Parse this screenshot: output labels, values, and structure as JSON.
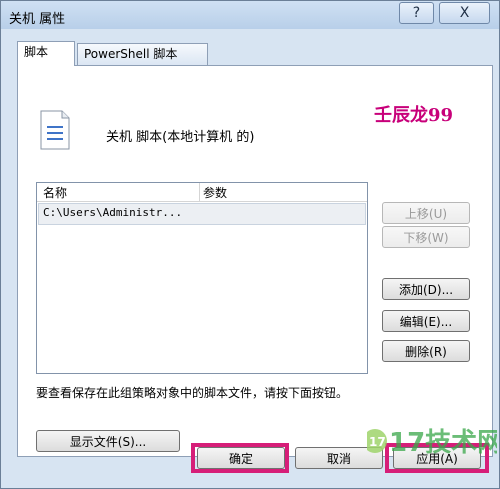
{
  "window": {
    "title": "关机 属性",
    "help_label": "?",
    "close_label": "X"
  },
  "tabs": [
    {
      "label": "脚本"
    },
    {
      "label": "PowerShell 脚本"
    }
  ],
  "watermark": "壬辰龙99",
  "header": {
    "text": "关机 脚本(本地计算机 的)"
  },
  "list": {
    "columns": [
      "名称",
      "参数"
    ],
    "rows": [
      {
        "name": "C:\\Users\\Administr...",
        "params": ""
      }
    ]
  },
  "side_buttons": {
    "up": "上移(U)",
    "down": "下移(W)",
    "add": "添加(D)...",
    "edit": "编辑(E)...",
    "remove": "删除(R)"
  },
  "bottom": {
    "note": "要查看保存在此组策略对象中的脚本文件，请按下面按钮。",
    "show_files": "显示文件(S)..."
  },
  "footer": {
    "ok": "确定",
    "cancel": "取消",
    "apply": "应用(A)"
  },
  "logo_text": "17技术网",
  "colors": {
    "highlight": "#d61e78",
    "watermark": "#c8007a",
    "logo": "#3aa84a"
  }
}
